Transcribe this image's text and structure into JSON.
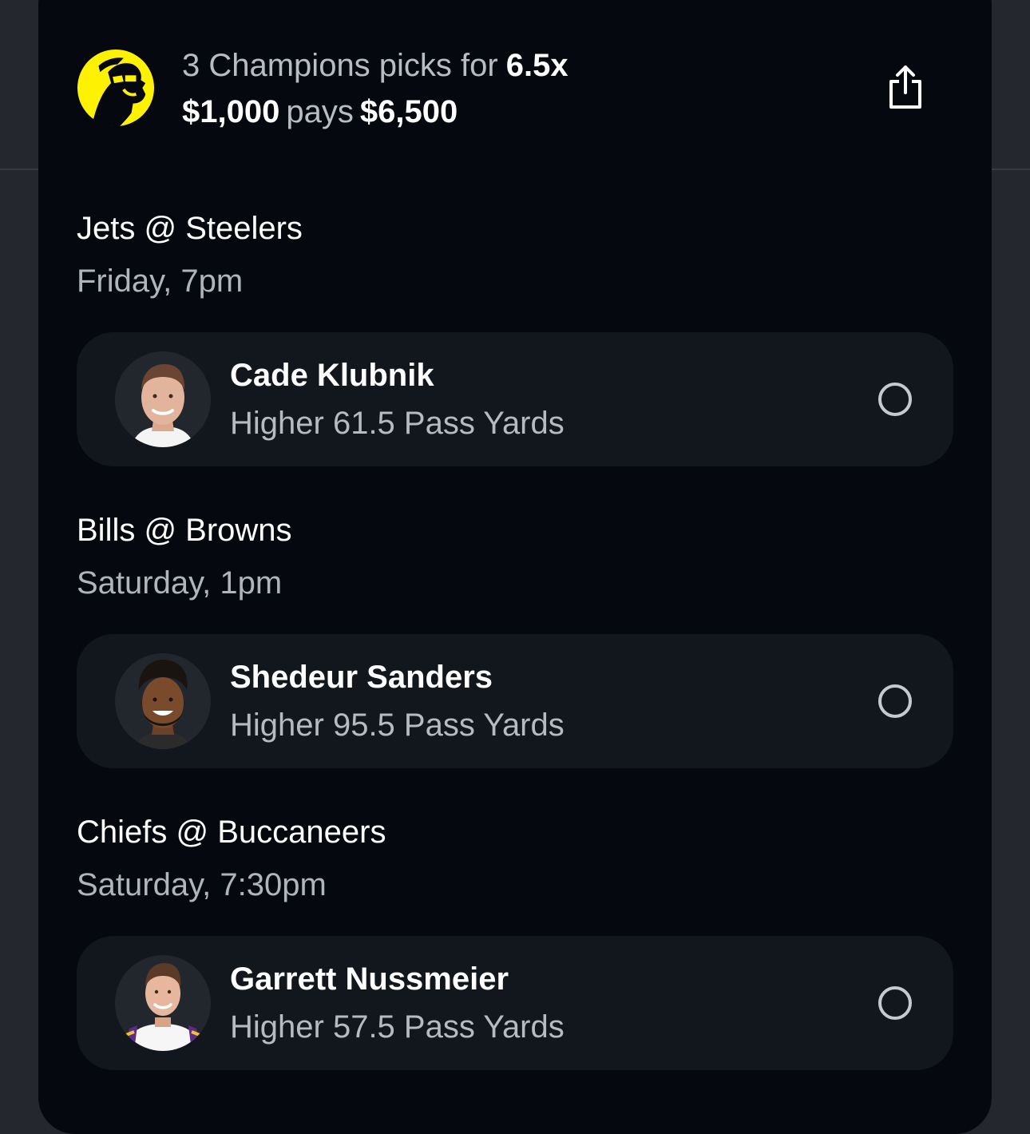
{
  "header": {
    "headline_prefix": "3 Champions picks for",
    "multiplier": "6.5x",
    "stake": "$1,000",
    "pays_word": "pays",
    "payout": "$6,500",
    "logo_icon": "champions-logo-icon",
    "share_icon": "share-icon"
  },
  "games": [
    {
      "matchup": "Jets @ Steelers",
      "time": "Friday, 7pm",
      "player": "Cade Klubnik",
      "pick": "Higher 61.5 Pass Yards"
    },
    {
      "matchup": "Bills @ Browns",
      "time": "Saturday, 1pm",
      "player": "Shedeur Sanders",
      "pick": "Higher 95.5 Pass Yards"
    },
    {
      "matchup": "Chiefs @ Buccaneers",
      "time": "Saturday, 7:30pm",
      "player": "Garrett Nussmeier",
      "pick": "Higher 57.5 Pass Yards"
    }
  ],
  "colors": {
    "background": "#24272d",
    "sheet": "#05090f",
    "card": "#12161d",
    "accent_yellow": "#fff200"
  }
}
